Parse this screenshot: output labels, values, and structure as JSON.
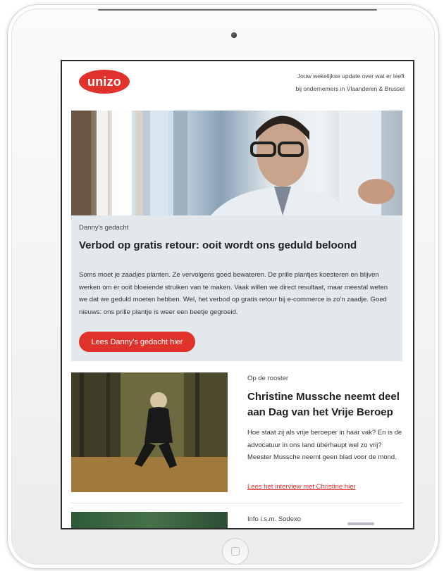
{
  "email": {
    "brand": {
      "logo_text": "unizo",
      "color": "#e0312b"
    },
    "tagline": {
      "line1": "Jouw wekelijkse update over wat er leeft",
      "line2": "bij ondernemers in Vlaanderen & Brussel"
    },
    "feature": {
      "eyebrow": "Danny's gedacht",
      "title": "Verbod op gratis retour: ooit wordt ons geduld beloond",
      "body": "Soms moet je zaadjes planten.  Ze vervolgens goed bewateren.  De prille plantjes koesteren en blijven werken om er ooit bloeiende struiken van te maken.  Vaak willen we direct resultaat, maar meestal weten we dat we geduld moeten hebben.  Wel, het verbod op gratis retour bij e-commerce is zo'n zaadje. Goed nieuws: ons prille plantje is weer een beetje gegroeid.",
      "cta": "Lees Danny's gedacht hier"
    },
    "article": {
      "eyebrow": "Op de rooster",
      "title": "Christine Mussche neemt deel aan Dag van het Vrije Beroep",
      "body": "Hoe staat zij als vrije beroeper in haar vak? En is de advocatuur in ons land überhaupt wel zo vrij? Meester Mussche neemt geen blad voor de mond.",
      "link": "Lees het interview met Christine hier"
    },
    "next": {
      "eyebrow": "Info i.s.m. Sodexo"
    }
  }
}
